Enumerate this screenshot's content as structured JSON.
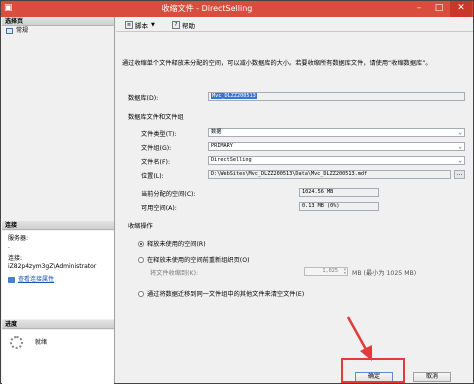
{
  "window": {
    "title": "收缩文件 - DirectSelling",
    "app_icon": "sql-server-icon",
    "controls": [
      "minimize",
      "maximize",
      "close"
    ],
    "accent_color": "#d94d3e"
  },
  "left_pane": {
    "pages_header": "选择页",
    "pages": [
      {
        "label": "常规",
        "icon": "page-icon"
      }
    ],
    "connection_header": "连接",
    "server_label": "服务器:",
    "server_value": ".",
    "connection_label": "连接:",
    "connection_value": "iZ82p4zym3gZ\\Administrator",
    "view_props_link": "查看连接属性",
    "progress_header": "进度",
    "progress_status": "就绪"
  },
  "toolbar": {
    "script_label": "脚本",
    "help_label": "帮助"
  },
  "main": {
    "description": "通过收缩单个文件释放未分配的空间，可以减小数据库的大小。若要收缩所有数据库文件，请使用“收缩数据库”。",
    "database_label": "数据库(D):",
    "database_value": "Mvc_DLZZ200513",
    "group_label": "数据库文件和文件组",
    "file_type_label": "文件类型(T):",
    "file_type_value": "数据",
    "filegroup_label": "文件组(G):",
    "filegroup_value": "PRIMARY",
    "filename_label": "文件名(F):",
    "filename_value": "DirectSelling",
    "location_label": "位置(L):",
    "location_value": "D:\\WebSites\\Mvc_DLZZ200513\\Data\\Mvc_DLZZ200513.mdf",
    "allocated_label": "当前分配的空间(C):",
    "allocated_value": "1024.56 MB",
    "available_label": "可用空间(A):",
    "available_value": "0.13 MB (0%)",
    "shrink_action_label": "收缩操作",
    "option_release": "释放未使用的空间(R)",
    "option_reorganize": "在释放未使用的空间前重新组织页(O)",
    "shrink_to_label": "将文件收缩到(K):",
    "shrink_to_value": "1,025",
    "shrink_to_unit": "MB (最小为 1025 MB)",
    "option_empty": "通过将数据迁移到同一文件组中的其他文件来清空文件(E)"
  },
  "footer": {
    "ok_label": "确定",
    "cancel_label": "取消"
  },
  "annotation": {
    "color": "#e23b3b"
  }
}
